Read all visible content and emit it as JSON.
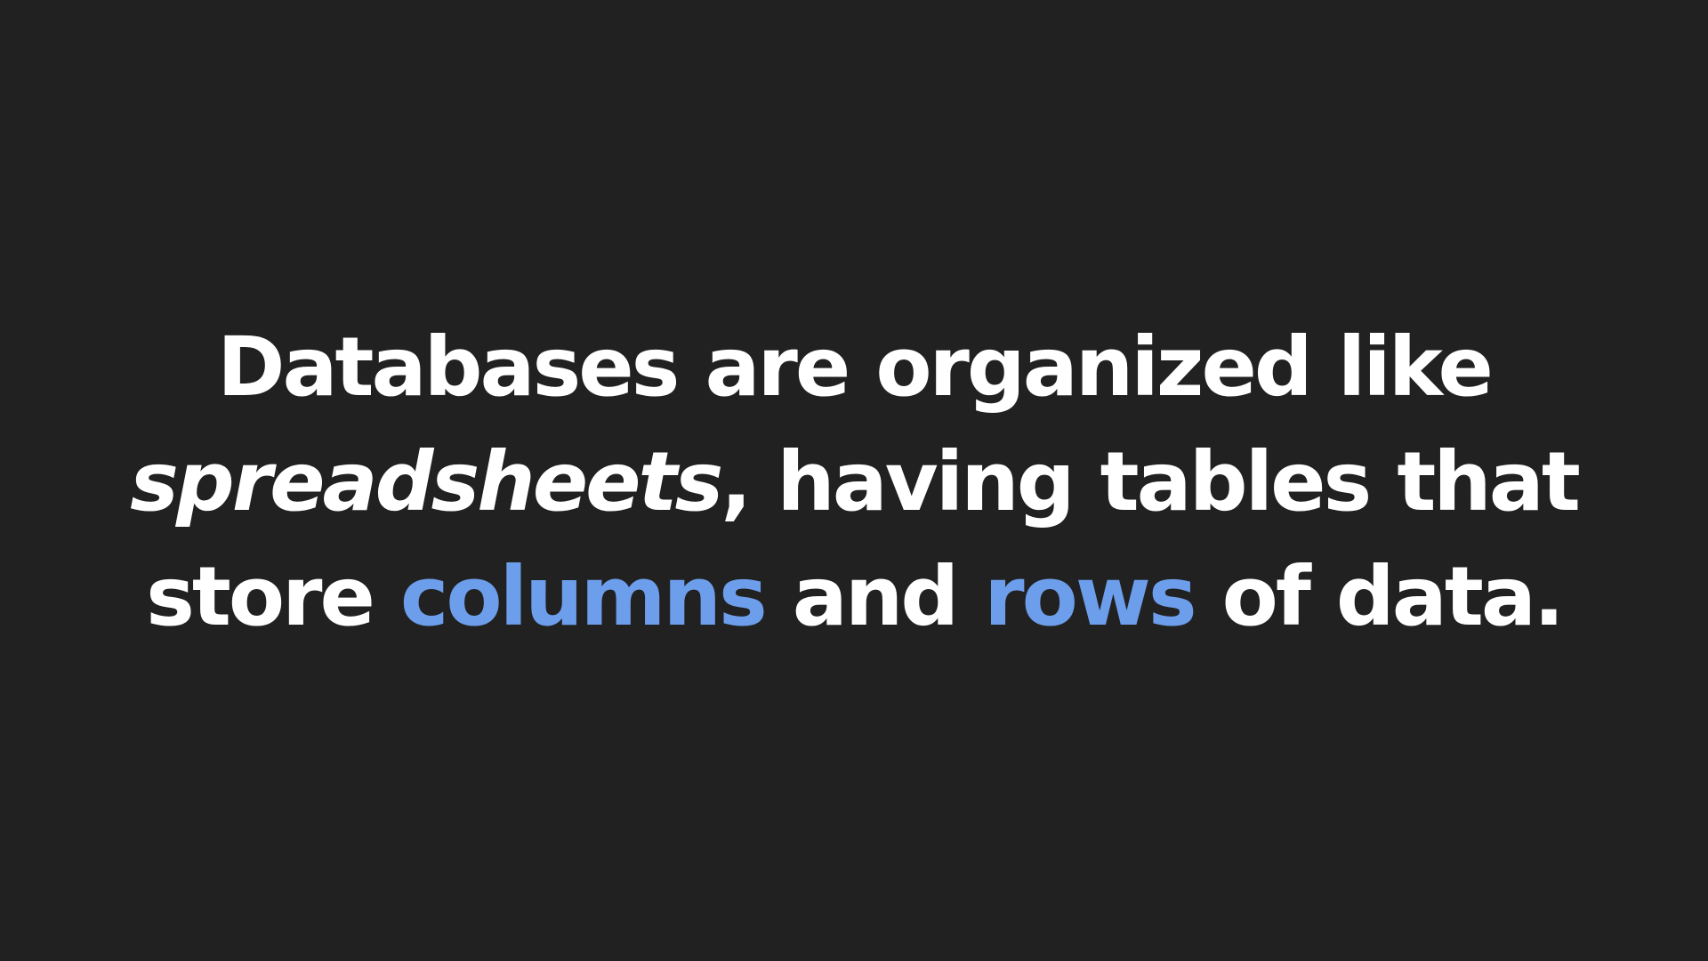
{
  "slide": {
    "line1": "Databases are organized like",
    "line2_emph": "spreadsheets",
    "line2_rest": ", having tables that",
    "line3_a": "store ",
    "line3_hl1": "columns",
    "line3_b": " and ",
    "line3_hl2": "rows",
    "line3_c": " of data."
  },
  "colors": {
    "background": "#212121",
    "text": "#ffffff",
    "highlight": "#6d9eeb"
  }
}
